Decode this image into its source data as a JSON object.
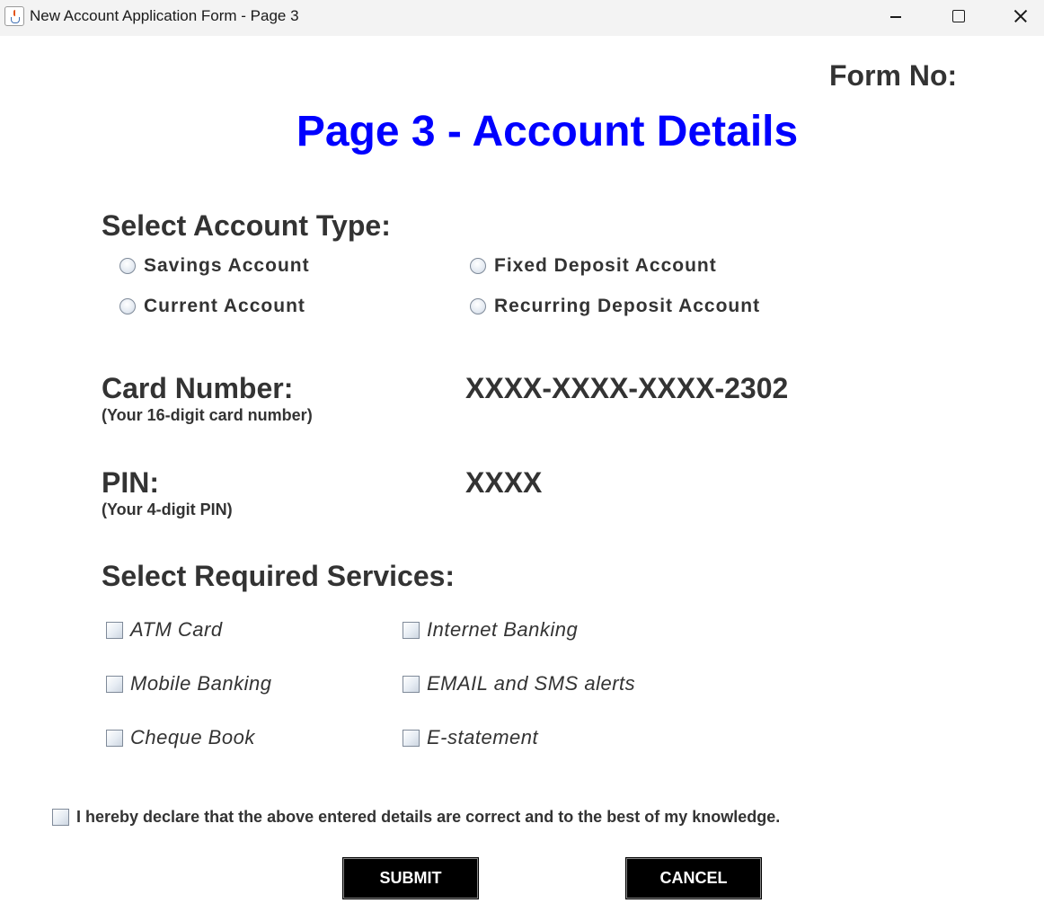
{
  "window": {
    "title": "New Account Application Form - Page 3",
    "controls": [
      "minimize-icon",
      "maximize-icon",
      "close-icon"
    ]
  },
  "header": {
    "form_no_label": "Form No:",
    "page_title": "Page 3 - Account Details",
    "page_title_color": "#0000ff"
  },
  "account_type": {
    "heading": "Select Account Type:",
    "options": [
      {
        "label": "Savings Account",
        "selected": false
      },
      {
        "label": "Fixed Deposit Account",
        "selected": false
      },
      {
        "label": "Current Account",
        "selected": false
      },
      {
        "label": "Recurring Deposit Account",
        "selected": false
      }
    ]
  },
  "card": {
    "label": "Card Number:",
    "hint": "(Your 16-digit card number)",
    "value": "XXXX-XXXX-XXXX-2302"
  },
  "pin": {
    "label": "PIN:",
    "hint": "(Your 4-digit PIN)",
    "value": "XXXX"
  },
  "services": {
    "heading": "Select Required Services:",
    "options": [
      {
        "label": "ATM Card",
        "checked": false
      },
      {
        "label": "Internet Banking",
        "checked": false
      },
      {
        "label": "Mobile Banking",
        "checked": false
      },
      {
        "label": "EMAIL and SMS alerts",
        "checked": false
      },
      {
        "label": "Cheque Book",
        "checked": false
      },
      {
        "label": "E-statement",
        "checked": false
      }
    ]
  },
  "declaration": {
    "label": "I hereby declare that the above entered details are correct and to the best of my knowledge.",
    "checked": false
  },
  "actions": {
    "submit_label": "SUBMIT",
    "cancel_label": "CANCEL",
    "button_bg": "#000000",
    "button_text_color": "#ffffff"
  }
}
